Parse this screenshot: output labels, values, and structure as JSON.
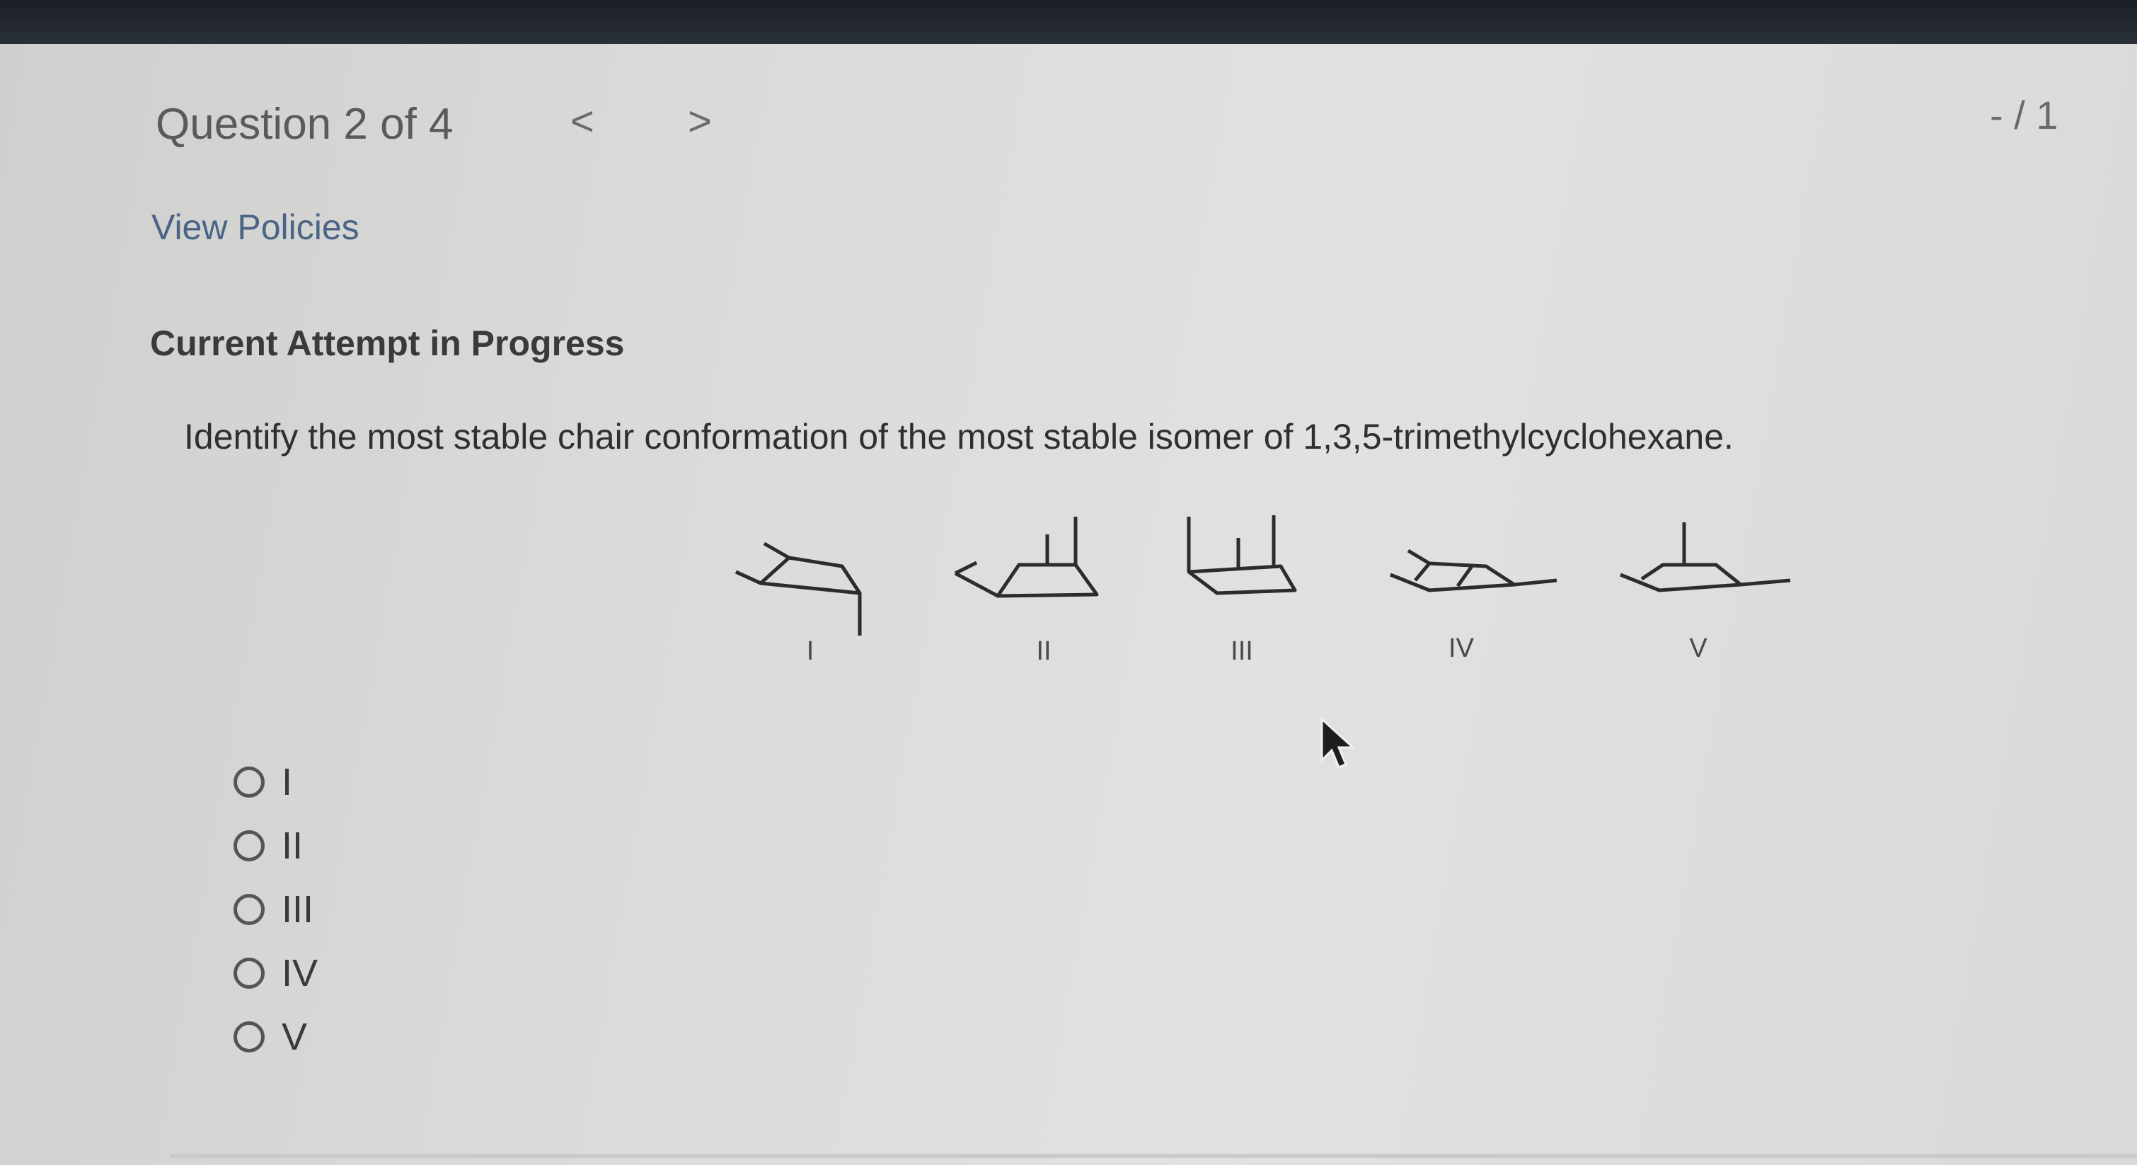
{
  "header": {
    "question_title": "Question 2 of 4",
    "prev_icon": "<",
    "next_icon": ">",
    "score": "- / 1"
  },
  "links": {
    "view_policies": "View Policies"
  },
  "status": {
    "attempt": "Current Attempt in Progress"
  },
  "question": {
    "text": "Identify the most stable chair conformation of the most stable isomer of 1,3,5-trimethylcyclohexane.",
    "structure_labels": [
      "I",
      "II",
      "III",
      "IV",
      "V"
    ]
  },
  "choices": [
    {
      "label": "I"
    },
    {
      "label": "II"
    },
    {
      "label": "III"
    },
    {
      "label": "IV"
    },
    {
      "label": "V"
    }
  ],
  "icons": {
    "prev": "chevron-left-icon",
    "next": "chevron-right-icon",
    "cursor": "mouse-pointer-icon"
  }
}
